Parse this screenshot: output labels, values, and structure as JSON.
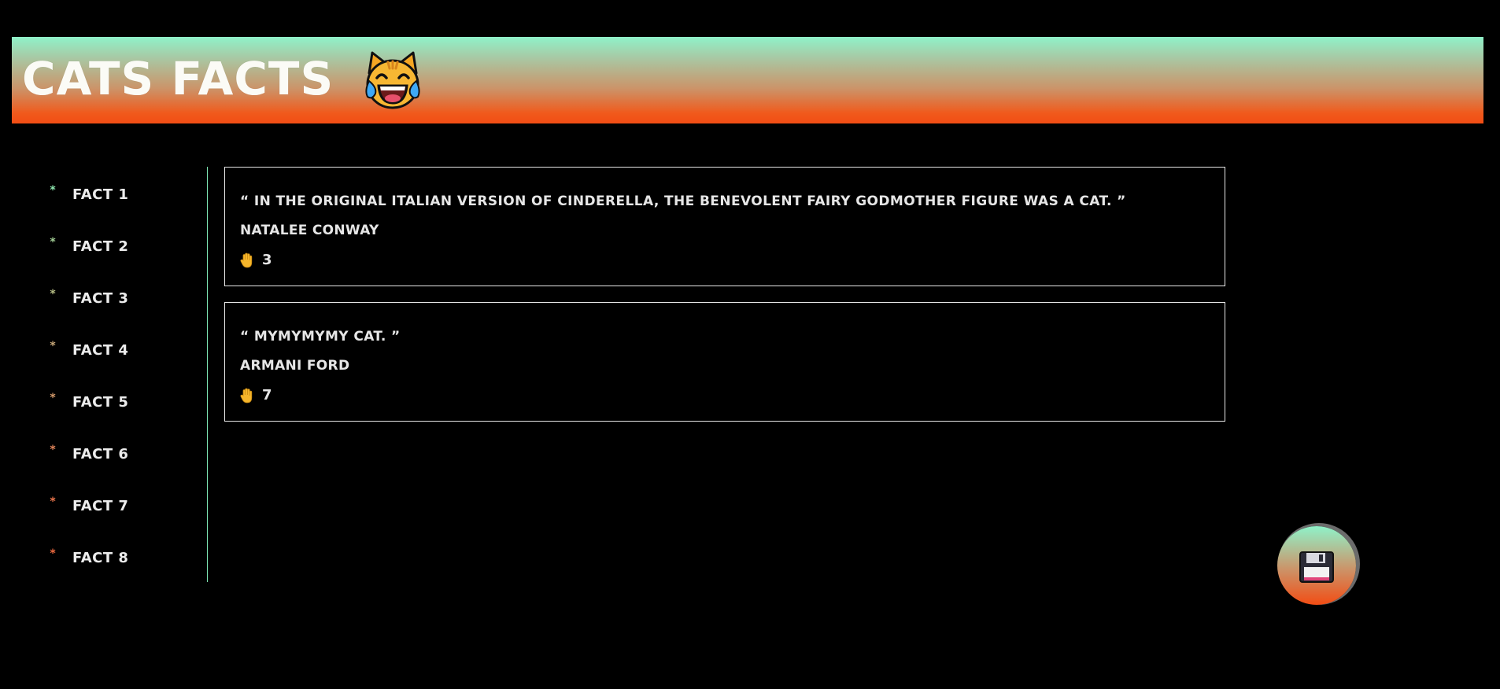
{
  "header": {
    "title": "CATS FACTS",
    "emoji_icon": "cat-with-tears-of-joy-icon",
    "gradient": [
      "#8ff2c9",
      "#f24d14"
    ]
  },
  "sidebar": {
    "items": [
      {
        "label": "FACT 1",
        "bullet": "*",
        "color": "#8fe8b0"
      },
      {
        "label": "FACT 2",
        "bullet": "*",
        "color": "#a3cf96"
      },
      {
        "label": "FACT 3",
        "bullet": "*",
        "color": "#b8bf86"
      },
      {
        "label": "FACT 4",
        "bullet": "*",
        "color": "#c9a97a"
      },
      {
        "label": "FACT 5",
        "bullet": "*",
        "color": "#d49a6b"
      },
      {
        "label": "FACT 6",
        "bullet": "*",
        "color": "#e0845a"
      },
      {
        "label": "FACT 7",
        "bullet": "*",
        "color": "#e8744b"
      },
      {
        "label": "FACT 8",
        "bullet": "*",
        "color": "#ee6a40"
      }
    ]
  },
  "facts": [
    {
      "quote": "“ IN THE ORIGINAL ITALIAN VERSION OF CINDERELLA, THE BENEVOLENT FAIRY GODMOTHER FIGURE WAS A CAT. ”",
      "author": "NATALEE CONWAY",
      "likes": "3",
      "icon": "raised-hand-icon"
    },
    {
      "quote": "“ MYMYMYMY CAT. ”",
      "author": "ARMANI FORD",
      "likes": "7",
      "icon": "raised-hand-icon"
    }
  ],
  "save_button": {
    "icon": "floppy-disk-icon"
  }
}
